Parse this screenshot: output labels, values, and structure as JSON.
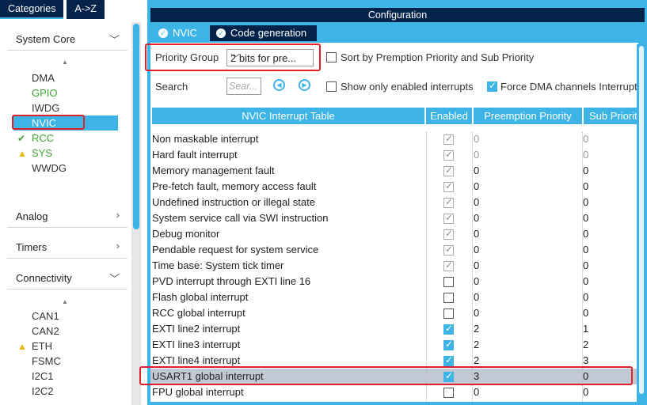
{
  "left": {
    "tabs": [
      "Categories",
      "A->Z"
    ],
    "groups": {
      "system_core": "System Core",
      "analog": "Analog",
      "timers": "Timers",
      "connectivity": "Connectivity"
    },
    "system_core_items": [
      {
        "label": "DMA",
        "status": "none"
      },
      {
        "label": "GPIO",
        "status": "green"
      },
      {
        "label": "IWDG",
        "status": "none"
      },
      {
        "label": "NVIC",
        "status": "selected"
      },
      {
        "label": "RCC",
        "status": "ok"
      },
      {
        "label": "SYS",
        "status": "warn"
      },
      {
        "label": "WWDG",
        "status": "none"
      }
    ],
    "connectivity_items": [
      {
        "label": "CAN1",
        "status": "none"
      },
      {
        "label": "CAN2",
        "status": "none"
      },
      {
        "label": "ETH",
        "status": "warn"
      },
      {
        "label": "FSMC",
        "status": "none"
      },
      {
        "label": "I2C1",
        "status": "none"
      },
      {
        "label": "I2C2",
        "status": "none"
      }
    ]
  },
  "config": {
    "title": "Configuration",
    "tabs": [
      "NVIC",
      "Code generation"
    ],
    "priority_group_label": "Priority Group",
    "priority_group_value": "2 bits for pre...",
    "sort_label": "Sort by Premption Priority and Sub Priority",
    "sort_checked": false,
    "search_label": "Search",
    "search_placeholder": "Sear...",
    "show_enabled_label": "Show only enabled interrupts",
    "show_enabled_checked": false,
    "force_dma_label": "Force DMA channels Interrupt",
    "force_dma_checked": true
  },
  "table": {
    "headers": [
      "NVIC Interrupt Table",
      "Enabled",
      "Preemption Priority",
      "Sub Priorit"
    ],
    "rows": [
      {
        "name": "Non maskable interrupt",
        "enabled": "locked",
        "pre": "0",
        "sub": "0",
        "dim": true
      },
      {
        "name": "Hard fault interrupt",
        "enabled": "locked",
        "pre": "0",
        "sub": "0",
        "dim": true
      },
      {
        "name": "Memory management fault",
        "enabled": "locked",
        "pre": "0",
        "sub": "0",
        "dim": false
      },
      {
        "name": "Pre-fetch fault, memory access fault",
        "enabled": "locked",
        "pre": "0",
        "sub": "0",
        "dim": false
      },
      {
        "name": "Undefined instruction or illegal state",
        "enabled": "locked",
        "pre": "0",
        "sub": "0",
        "dim": false
      },
      {
        "name": "System service call via SWI instruction",
        "enabled": "locked",
        "pre": "0",
        "sub": "0",
        "dim": false
      },
      {
        "name": "Debug monitor",
        "enabled": "locked",
        "pre": "0",
        "sub": "0",
        "dim": false
      },
      {
        "name": "Pendable request for system service",
        "enabled": "locked",
        "pre": "0",
        "sub": "0",
        "dim": false
      },
      {
        "name": "Time base: System tick timer",
        "enabled": "locked",
        "pre": "0",
        "sub": "0",
        "dim": false
      },
      {
        "name": "PVD interrupt through EXTI line 16",
        "enabled": "off",
        "pre": "0",
        "sub": "0",
        "dim": false
      },
      {
        "name": "Flash global interrupt",
        "enabled": "off",
        "pre": "0",
        "sub": "0",
        "dim": false
      },
      {
        "name": "RCC global interrupt",
        "enabled": "off",
        "pre": "0",
        "sub": "0",
        "dim": false
      },
      {
        "name": "EXTI line2 interrupt",
        "enabled": "on",
        "pre": "2",
        "sub": "1",
        "dim": false
      },
      {
        "name": "EXTI line3 interrupt",
        "enabled": "on",
        "pre": "2",
        "sub": "2",
        "dim": false
      },
      {
        "name": "EXTI line4 interrupt",
        "enabled": "on",
        "pre": "2",
        "sub": "3",
        "dim": false
      },
      {
        "name": "USART1 global interrupt",
        "enabled": "on",
        "pre": "3",
        "sub": "0",
        "dim": false,
        "selected": true
      },
      {
        "name": "FPU global interrupt",
        "enabled": "off",
        "pre": "0",
        "sub": "0",
        "dim": false
      }
    ]
  },
  "colors": {
    "accent": "#3cb4e6",
    "navy": "#03234b",
    "highlight": "#e0202a",
    "selected_row": "#c2c8d4",
    "ok_green": "#3fa535",
    "warn_yellow": "#e8b90b"
  }
}
